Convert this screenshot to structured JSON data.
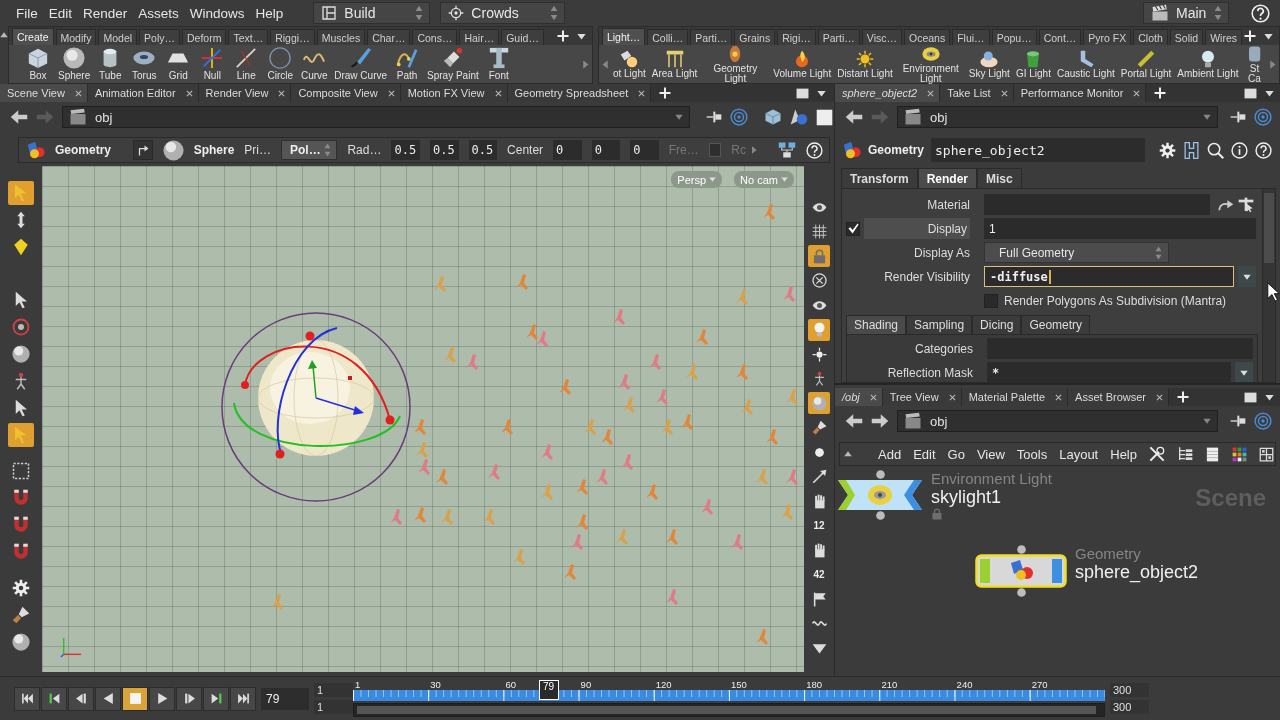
{
  "menu_bar": {
    "menus": [
      "File",
      "Edit",
      "Render",
      "Assets",
      "Windows",
      "Help"
    ],
    "desktops": [
      {
        "label": "Build"
      },
      {
        "label": "Crowds"
      }
    ],
    "desktop_right": {
      "label": "Main"
    }
  },
  "shelves": [
    {
      "tabs": [
        {
          "label": "Create",
          "selected": true
        },
        {
          "label": "Modify",
          "selected": false
        },
        {
          "label": "Model",
          "selected": false
        },
        {
          "label": "Poly…",
          "selected": false
        },
        {
          "label": "Deform",
          "selected": false
        },
        {
          "label": "Text…",
          "selected": false
        },
        {
          "label": "Riggi…",
          "selected": false
        },
        {
          "label": "Muscles",
          "selected": false
        },
        {
          "label": "Char…",
          "selected": false
        },
        {
          "label": "Cons…",
          "selected": false
        },
        {
          "label": "Hair…",
          "selected": false
        },
        {
          "label": "Guid…",
          "selected": false
        }
      ],
      "tools": [
        "Box",
        "Sphere",
        "Tube",
        "Torus",
        "Grid",
        "Null",
        "Line",
        "Circle",
        "Curve",
        "Draw Curve",
        "Path",
        "Spray Paint",
        "Font"
      ]
    },
    {
      "tabs": [
        {
          "label": "Light…",
          "selected": true
        },
        {
          "label": "Colli…",
          "selected": false
        },
        {
          "label": "Parti…",
          "selected": false
        },
        {
          "label": "Grains",
          "selected": false
        },
        {
          "label": "Rigi…",
          "selected": false
        },
        {
          "label": "Parti…",
          "selected": false
        },
        {
          "label": "Visc…",
          "selected": false
        },
        {
          "label": "Oceans",
          "selected": false
        },
        {
          "label": "Flui…",
          "selected": false
        },
        {
          "label": "Popu…",
          "selected": false
        },
        {
          "label": "Cont…",
          "selected": false
        },
        {
          "label": "Pyro FX",
          "selected": false
        },
        {
          "label": "Cloth",
          "selected": false
        },
        {
          "label": "Solid",
          "selected": false
        },
        {
          "label": "Wires",
          "selected": false
        }
      ],
      "tools": [
        "ot Light",
        "Area Light",
        "Geometry Light",
        "Volume Light",
        "Distant Light",
        "Environment Light",
        "Sky Light",
        "GI Light",
        "Caustic Light",
        "Portal Light",
        "Ambient Light",
        "St Ca"
      ]
    }
  ],
  "scene_pane": {
    "tabs": [
      {
        "label": "Scene View",
        "selected": true
      },
      {
        "label": "Animation Editor",
        "selected": false
      },
      {
        "label": "Render View",
        "selected": false
      },
      {
        "label": "Composite View",
        "selected": false
      },
      {
        "label": "Motion FX View",
        "selected": false
      },
      {
        "label": "Geometry Spreadsheet",
        "selected": false
      }
    ],
    "path": {
      "text": "obj",
      "forward_disabled": true
    },
    "operation": {
      "node_type": "Geometry",
      "node_name": "Sphere",
      "items": [
        {
          "kind": "label",
          "text": "Pri…",
          "disabled": false
        },
        {
          "kind": "menu",
          "text": "Pol…",
          "disabled": false
        },
        {
          "kind": "label",
          "text": "Rad…",
          "disabled": false
        },
        {
          "kind": "number",
          "text": "0.5",
          "disabled": false
        },
        {
          "kind": "number",
          "text": "0.5",
          "disabled": false
        },
        {
          "kind": "number",
          "text": "0.5",
          "disabled": false
        },
        {
          "kind": "label",
          "text": "Center",
          "disabled": false
        },
        {
          "kind": "number",
          "text": "0",
          "disabled": false
        },
        {
          "kind": "number",
          "text": "0",
          "disabled": false
        },
        {
          "kind": "number",
          "text": "0",
          "disabled": false
        },
        {
          "kind": "label",
          "text": "Fre…",
          "disabled": true
        },
        {
          "kind": "toggle",
          "disabled": true
        },
        {
          "kind": "more",
          "text": "Rc",
          "disabled": true
        }
      ]
    },
    "viewport": {
      "camera_menus": [
        {
          "label": "Persp"
        },
        {
          "label": "No cam"
        }
      ]
    },
    "tools": [
      {
        "selected": true
      },
      {
        "selected": false
      },
      {
        "selected": false
      },
      {
        "selected": false
      },
      {
        "selected": false
      },
      {
        "selected": false
      },
      {
        "selected": false
      },
      {
        "selected": false
      },
      {
        "selected": true
      },
      {
        "selected": false
      },
      {
        "selected": false
      },
      {
        "selected": false
      },
      {
        "selected": false
      },
      {
        "selected": false
      },
      {
        "selected": false
      },
      {
        "selected": false
      }
    ],
    "display_tools": [
      {
        "selected": false
      },
      {
        "selected": false
      },
      {
        "selected": true
      },
      {
        "selected": false
      },
      {
        "selected": false
      },
      {
        "selected": true
      },
      {
        "selected": false
      },
      {
        "selected": false
      },
      {
        "selected": true
      },
      {
        "selected": false
      },
      {
        "selected": false
      },
      {
        "selected": false
      },
      {
        "selected": false
      },
      {
        "selected": false,
        "text": "12"
      },
      {
        "selected": false
      },
      {
        "selected": false,
        "text": "42"
      },
      {
        "selected": false
      },
      {
        "selected": false
      },
      {
        "selected": false
      }
    ]
  },
  "parameter_pane": {
    "tabs": [
      {
        "label": "sphere_object2",
        "selected": true
      },
      {
        "label": "Take List",
        "selected": false
      },
      {
        "label": "Performance Monitor",
        "selected": false
      }
    ],
    "path": {
      "text": "obj",
      "forward_disabled": true
    },
    "node_type": "Geometry",
    "node_name": "sphere_object2",
    "folders": [
      {
        "label": "Transform",
        "selected": false
      },
      {
        "label": "Render",
        "selected": true
      },
      {
        "label": "Misc",
        "selected": false
      }
    ],
    "params": [
      {
        "kind": "operator_path",
        "label": "Material"
      },
      {
        "kind": "toggle_field",
        "label": "Display",
        "checked": true,
        "value": "1"
      },
      {
        "kind": "menu",
        "label": "Display As",
        "value": "Full Geometry"
      },
      {
        "kind": "string_menu",
        "label": "Render Visibility",
        "value": "-diffuse",
        "focused": true
      },
      {
        "kind": "checkbox",
        "label": "Render Polygons As Subdivision (Mantra)",
        "checked": false
      }
    ],
    "subfolders": [
      {
        "label": "Shading",
        "selected": true
      },
      {
        "label": "Sampling",
        "selected": false
      },
      {
        "label": "Dicing",
        "selected": false
      },
      {
        "label": "Geometry",
        "selected": false
      }
    ],
    "subparams": [
      {
        "kind": "field",
        "label": "Categories"
      },
      {
        "kind": "string_menu",
        "label": "Reflection Mask",
        "value": "*",
        "focused": false
      }
    ]
  },
  "network_pane": {
    "tabs": [
      {
        "label": "/obj",
        "selected": true
      },
      {
        "label": "Tree View",
        "selected": false
      },
      {
        "label": "Material Palette",
        "selected": false
      },
      {
        "label": "Asset Browser",
        "selected": false
      }
    ],
    "path": {
      "text": "obj",
      "forward_disabled": false
    },
    "menus": [
      "Add",
      "Edit",
      "Go",
      "View",
      "Tools",
      "Layout",
      "Help"
    ],
    "context": "Scene",
    "nodes": [
      {
        "kind": "light",
        "type": "Environment Light",
        "name": "skylight1",
        "selected": false,
        "locked": true
      },
      {
        "kind": "geometry",
        "type": "Geometry",
        "name": "sphere_object2",
        "selected": true,
        "locked": false
      }
    ]
  },
  "timeline": {
    "buttons": [
      {
        "selected": false
      },
      {
        "selected": false
      },
      {
        "selected": false
      },
      {
        "selected": false
      },
      {
        "selected": true
      },
      {
        "selected": false
      },
      {
        "selected": false
      },
      {
        "selected": false
      },
      {
        "selected": false
      }
    ],
    "frame": "79",
    "start": [
      "1",
      "1"
    ],
    "ticks": [
      "1",
      "30",
      "60",
      "90",
      "120",
      "150",
      "180",
      "210",
      "240",
      "270"
    ],
    "playhead": {
      "label": "79",
      "level": 0.26
    },
    "range_bar": {
      "level": 1
    },
    "end": [
      "300",
      "300"
    ]
  }
}
